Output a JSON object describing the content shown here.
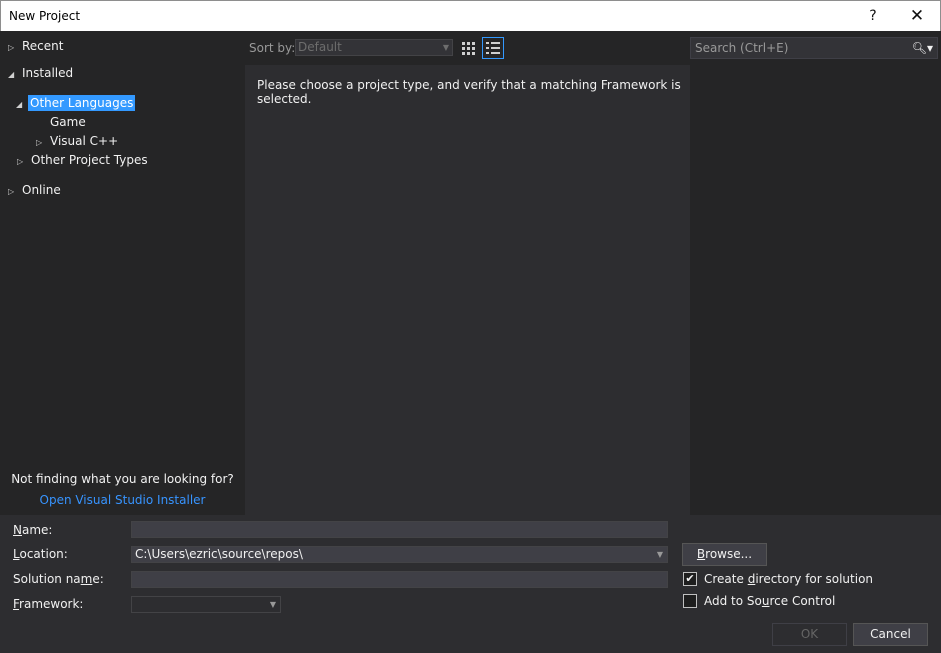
{
  "window": {
    "title": "New Project",
    "help_glyph": "?",
    "close_glyph": "✕"
  },
  "tree": {
    "recent": "Recent",
    "installed": "Installed",
    "other_languages": "Other Languages",
    "game": "Game",
    "visual_cpp": "Visual C++",
    "other_project_types": "Other Project Types",
    "online": "Online"
  },
  "help": {
    "not_finding": "Not finding what you are looking for?",
    "installer_link": "Open Visual Studio Installer"
  },
  "toolbar": {
    "sort_label": "Sort by:",
    "sort_value": "Default"
  },
  "search": {
    "placeholder": "Search (Ctrl+E)"
  },
  "main": {
    "message": "Please choose a project type, and verify that a matching Framework is selected."
  },
  "form": {
    "name_label": "Name:",
    "name_value": "",
    "location_label": "Location:",
    "location_value": "C:\\Users\\ezric\\source\\repos\\",
    "solution_label": "Solution name:",
    "solution_value": "",
    "framework_label": "Framework:",
    "framework_value": "",
    "browse": "Browse...",
    "create_dir_label": "Create directory for solution",
    "create_dir_checked": true,
    "source_control_label": "Add to Source Control",
    "source_control_checked": false,
    "ok": "OK",
    "cancel": "Cancel"
  }
}
